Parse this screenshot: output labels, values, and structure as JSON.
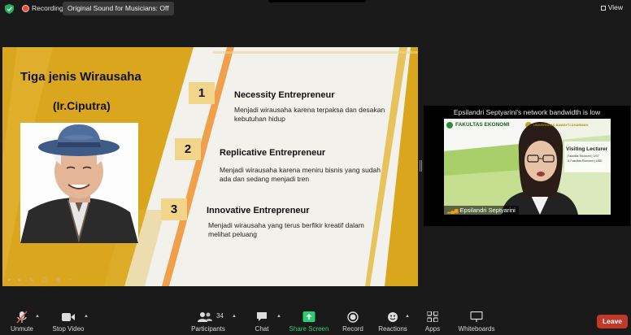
{
  "topbar": {
    "recording_label": "Recording",
    "original_sound": "Original Sound for Musicians: Off",
    "view_label": "View"
  },
  "slide": {
    "title": "Tiga jenis Wirausaha",
    "subtitle": "(Ir.Ciputra)",
    "items": [
      {
        "number": "1",
        "title": "Necessity Entrepreneur",
        "desc": "Menjadi wirausaha karena terpaksa dan desakan kebutuhan hidup"
      },
      {
        "number": "2",
        "title": "Replicative Entrepreneur",
        "desc": "Menjadi wirausaha karena meniru bisnis yang sudah ada dan sedang menjadi tren"
      },
      {
        "number": "3",
        "title": "Innovative Entrepreneur",
        "desc": "Menjadi wirausaha yang terus berfikir kreatif dalam melihat peluang"
      }
    ],
    "colors": {
      "gold": "#d9a61e",
      "light_gold": "#f1d58a",
      "orange": "#f0a04b",
      "paper": "#f3f1ec"
    }
  },
  "video": {
    "bandwidth_message": "Epsilandri Septyarini's network bandwidth is low",
    "participant_name": "Epsilandri Septyarini",
    "background": {
      "faculty": "FAKULTAS EKONOMI",
      "university": "UNIVERSITAS BAWAYTI DHARMAN",
      "banner_title": "Visiting Lecturer",
      "banner_line1": "Fakultas Ekonomi | UST",
      "banner_line2": "& Fakultas Ekonomi | UBD"
    }
  },
  "toolbar": {
    "unmute": "Unmute",
    "stop_video": "Stop Video",
    "participants": "Participants",
    "participants_count": "34",
    "chat": "Chat",
    "share_screen": "Share Screen",
    "record": "Record",
    "reactions": "Reactions",
    "apps": "Apps",
    "whiteboards": "Whiteboards",
    "leave": "Leave",
    "share_color": "#2ecc71",
    "leave_color": "#c0392b"
  }
}
